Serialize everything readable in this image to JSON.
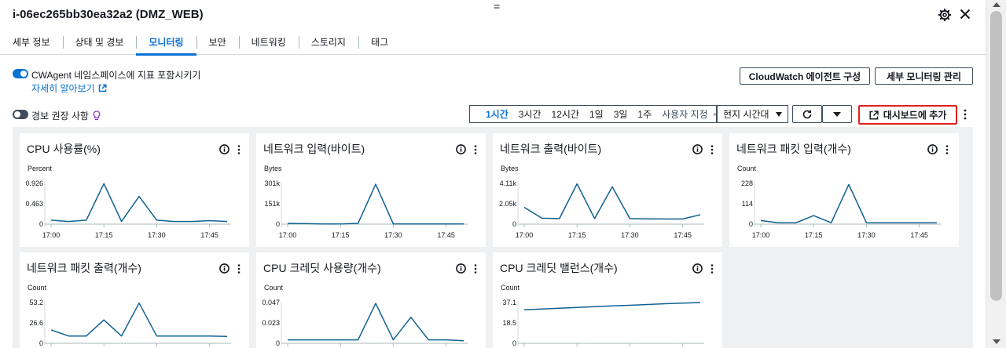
{
  "header": {
    "title": "i-06ec265bb30ea32a2 (DMZ_WEB)",
    "drag_glyph": "="
  },
  "tabs": [
    {
      "label": "세부 정보",
      "active": false
    },
    {
      "label": "상태 및 경보",
      "active": false
    },
    {
      "label": "모니터링",
      "active": true
    },
    {
      "label": "보안",
      "active": false
    },
    {
      "label": "네트워킹",
      "active": false
    },
    {
      "label": "스토리지",
      "active": false
    },
    {
      "label": "태그",
      "active": false
    }
  ],
  "options": {
    "cwagent_label": "CWAgent 네임스페이스에 지표 포함시키기",
    "cwagent_enabled": true,
    "learn_more": "자세히 알아보기",
    "alarm_label": "경보 권장 사항",
    "alarm_enabled": false
  },
  "buttons": {
    "cloudwatch_agent": "CloudWatch 에이전트 구성",
    "detailed_monitoring": "세부 모니터링 관리",
    "add_to_dashboard": "대시보드에 추가"
  },
  "time_range": {
    "options": [
      "1시간",
      "3시간",
      "12시간",
      "1일",
      "3일",
      "1주"
    ],
    "active": "1시간",
    "custom": "사용자 지정",
    "timezone": "현지 시간대"
  },
  "colors": {
    "accent": "#0972d3",
    "series": "#0f6191",
    "highlight_border": "#e0201f"
  },
  "chart_data": [
    {
      "type": "line",
      "title": "CPU 사용률(%)",
      "unit": "Percent",
      "x": [
        "17:00",
        "17:05",
        "17:10",
        "17:15",
        "17:20",
        "17:25",
        "17:30",
        "17:35",
        "17:40",
        "17:45",
        "17:50"
      ],
      "x_ticks": [
        "17:00",
        "17:15",
        "17:30",
        "17:45"
      ],
      "y_ticks": [
        "0.926",
        "0.463",
        "0"
      ],
      "ylim": [
        0,
        0.926
      ],
      "values": [
        0.09,
        0.06,
        0.09,
        0.92,
        0.06,
        0.63,
        0.09,
        0.06,
        0.06,
        0.08,
        0.06
      ]
    },
    {
      "type": "line",
      "title": "네트워크 입력(바이트)",
      "unit": "Bytes",
      "x": [
        "17:00",
        "17:05",
        "17:10",
        "17:15",
        "17:20",
        "17:25",
        "17:30",
        "17:35",
        "17:40",
        "17:45",
        "17:50"
      ],
      "x_ticks": [
        "17:00",
        "17:15",
        "17:30",
        "17:45"
      ],
      "y_ticks": [
        "301k",
        "151k",
        "0"
      ],
      "ylim": [
        0,
        301000
      ],
      "values": [
        6000,
        4000,
        2000,
        1000,
        6000,
        295000,
        2000,
        1000,
        1000,
        1000,
        1000
      ]
    },
    {
      "type": "line",
      "title": "네트워크 출력(바이트)",
      "unit": "Bytes",
      "x": [
        "17:00",
        "17:05",
        "17:10",
        "17:15",
        "17:20",
        "17:25",
        "17:30",
        "17:35",
        "17:40",
        "17:45",
        "17:50"
      ],
      "x_ticks": [
        "17:00",
        "17:15",
        "17:30",
        "17:45"
      ],
      "y_ticks": [
        "4.11k",
        "2.05k",
        "0"
      ],
      "ylim": [
        0,
        4110
      ],
      "values": [
        1700,
        600,
        560,
        4070,
        560,
        3770,
        560,
        540,
        520,
        520,
        950
      ]
    },
    {
      "type": "line",
      "title": "네트워크 패킷 입력(개수)",
      "unit": "Count",
      "x": [
        "17:00",
        "17:05",
        "17:10",
        "17:15",
        "17:20",
        "17:25",
        "17:30",
        "17:35",
        "17:40",
        "17:45",
        "17:50"
      ],
      "x_ticks": [
        "17:00",
        "17:15",
        "17:30",
        "17:45"
      ],
      "y_ticks": [
        "228",
        "114",
        "0"
      ],
      "ylim": [
        0,
        228
      ],
      "values": [
        20,
        8,
        8,
        48,
        8,
        222,
        8,
        8,
        8,
        8,
        8
      ]
    },
    {
      "type": "line",
      "title": "네트워크 패킷 출력(개수)",
      "unit": "Count",
      "x": [
        "17:00",
        "17:05",
        "17:10",
        "17:15",
        "17:20",
        "17:25",
        "17:30",
        "17:35",
        "17:40",
        "17:45",
        "17:50"
      ],
      "x_ticks": [],
      "y_ticks": [
        "53.2",
        "26.6",
        "0"
      ],
      "ylim": [
        0,
        53.2
      ],
      "values": [
        17.5,
        9.5,
        9.5,
        30.5,
        9.5,
        52.5,
        9.5,
        9.5,
        9.5,
        9.5,
        9.0
      ]
    },
    {
      "type": "line",
      "title": "CPU 크레딧 사용량(개수)",
      "unit": "Count",
      "x": [
        "17:00",
        "17:05",
        "17:10",
        "17:15",
        "17:20",
        "17:25",
        "17:30",
        "17:35",
        "17:40",
        "17:45",
        "17:50"
      ],
      "x_ticks": [],
      "y_ticks": [
        "0.047",
        "0.023",
        "0"
      ],
      "ylim": [
        0,
        0.047
      ],
      "values": [
        0.004,
        0.004,
        0.004,
        0.004,
        0.004,
        0.046,
        0.004,
        0.03,
        0.004,
        0.004,
        0.003
      ]
    },
    {
      "type": "line",
      "title": "CPU 크레딧 밸런스(개수)",
      "unit": "Count",
      "x": [
        "17:00",
        "17:05",
        "17:10",
        "17:15",
        "17:20",
        "17:25",
        "17:30",
        "17:35",
        "17:40",
        "17:45",
        "17:50"
      ],
      "x_ticks": [],
      "y_ticks": [
        "37.1",
        "18.5",
        "0"
      ],
      "ylim": [
        0,
        37.1
      ],
      "values": [
        30.5,
        31.2,
        31.9,
        32.6,
        33.3,
        34.0,
        34.6,
        35.3,
        36.0,
        36.6,
        37.1
      ]
    }
  ]
}
